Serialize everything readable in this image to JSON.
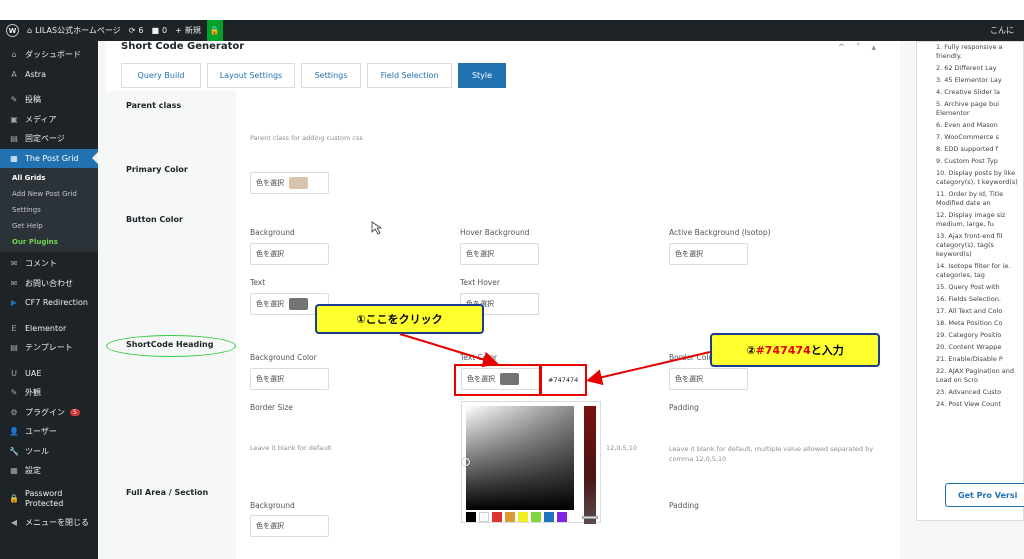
{
  "adminbar": {
    "site_icon": "home-icon",
    "site_name": "LILAS公式ホームページ",
    "updates": "6",
    "comments": "0",
    "new": "新規",
    "greeting": "こんに"
  },
  "sidebar": {
    "items": [
      {
        "icon": "⌂",
        "label": "ダッシュボード"
      },
      {
        "icon": "A",
        "label": "Astra"
      },
      {
        "icon": "✎",
        "label": "投稿"
      },
      {
        "icon": "▣",
        "label": "メディア"
      },
      {
        "icon": "▤",
        "label": "固定ページ"
      },
      {
        "icon": "▦",
        "label": "The Post Grid"
      },
      {
        "icon": "✉",
        "label": "コメント"
      },
      {
        "icon": "✉",
        "label": "お問い合わせ"
      },
      {
        "icon": "▶",
        "label": "CF7 Redirection"
      },
      {
        "icon": "E",
        "label": "Elementor"
      },
      {
        "icon": "▤",
        "label": "テンプレート"
      },
      {
        "icon": "U",
        "label": "UAE"
      },
      {
        "icon": "✎",
        "label": "外観"
      },
      {
        "icon": "⚙",
        "label": "プラグイン"
      },
      {
        "icon": "👤",
        "label": "ユーザー"
      },
      {
        "icon": "🔧",
        "label": "ツール"
      },
      {
        "icon": "▦",
        "label": "設定"
      },
      {
        "icon": "🔒",
        "label": "Password Protected"
      },
      {
        "icon": "◀",
        "label": "メニューを閉じる"
      }
    ],
    "plugin_badge": "5",
    "submenu": [
      "All Grids",
      "Add New Post Grid",
      "Settings",
      "Get Help",
      "Our Plugins"
    ]
  },
  "panel": {
    "title": "Short Code Generator",
    "controls": "^ ˅ ▴",
    "tabs": [
      "Query Build",
      "Layout Settings",
      "Settings",
      "Field Selection",
      "Style"
    ]
  },
  "sections": {
    "parent_class": "Parent class",
    "parent_class_hint": "Parent class for adding custom css",
    "primary_color": "Primary Color",
    "button_color": "Button Color",
    "shortcode_heading": "ShortCode Heading",
    "full_area": "Full Area / Section"
  },
  "labels": {
    "select_color": "色を選択",
    "background": "Background",
    "hover_background": "Hover Background",
    "active_background": "Active Background (Isotop)",
    "text": "Text",
    "text_hover": "Text Hover",
    "background_color": "Background Color",
    "text_color": "Text Color",
    "border_color": "Border Color",
    "border_size": "Border Size",
    "padding": "Padding",
    "hint_default": "Leave it blank for default",
    "hint_multi": "Leave it blank for default, multiple value allowed separated by comma 12,0,5,10",
    "hint_partial": "12,0,5,10",
    "hex_value": "#747474"
  },
  "annotations": {
    "click_here": "①ここをクリック",
    "enter_value_prefix": "②",
    "enter_value_hex": "#747474",
    "enter_value_suffix": "と入力"
  },
  "colors": {
    "primary_swatch": "#d9c3ac",
    "text_swatch": "#747474",
    "accent": "#2271b1"
  },
  "features": [
    "1. Fully responsive a friendly.",
    "2. 62 Different Lay",
    "3. 45 Elementor Lay",
    "4. Creative Slider la",
    "5. Archive page bui Elementor",
    "6. Even and Mason",
    "7. WooCommerce s",
    "8. EDD supported f",
    "9. Custom Post Typ",
    "10. Display posts by like category(s), t keyword(s)",
    "11. Order by Id, Title Modified date an",
    "12. Display image siz medium, large, fu",
    "13. Ajax front-end fil category(s), tag(s keyword(s)",
    "14. Isotope filter for ie. categories, tag",
    "15. Query Post with",
    "16. Fields Selection.",
    "17. All Text and Colo",
    "18. Meta Position Co",
    "19. Category Positio",
    "20. Content Wrappe",
    "21. Enable/Disable P",
    "22. AJAX Pagination and Load on Scro",
    "23. Advanced Custo",
    "24. Post View Count"
  ],
  "pro_button": "Get Pro Versi"
}
